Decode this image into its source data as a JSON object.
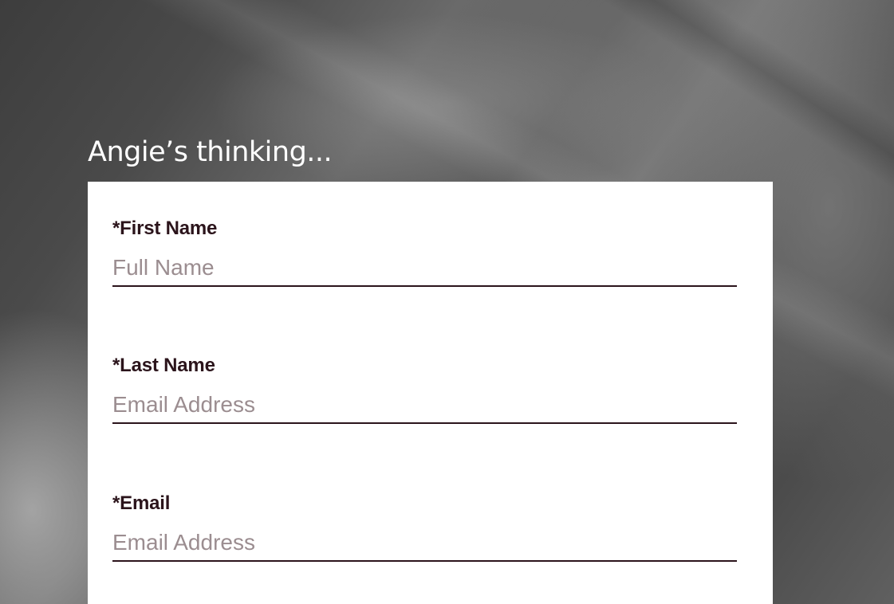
{
  "heading": "Angie’s thinking...",
  "form": {
    "fields": [
      {
        "label": "*First Name",
        "placeholder": "Full Name",
        "value": ""
      },
      {
        "label": "*Last Name",
        "placeholder": "Email Address",
        "value": ""
      },
      {
        "label": "*Email",
        "placeholder": "Email Address",
        "value": ""
      }
    ]
  },
  "colors": {
    "label_text": "#2b141b",
    "placeholder_text": "#9b8d90",
    "underline": "#2b141b",
    "card_background": "#ffffff",
    "heading_text": "#ffffff"
  }
}
